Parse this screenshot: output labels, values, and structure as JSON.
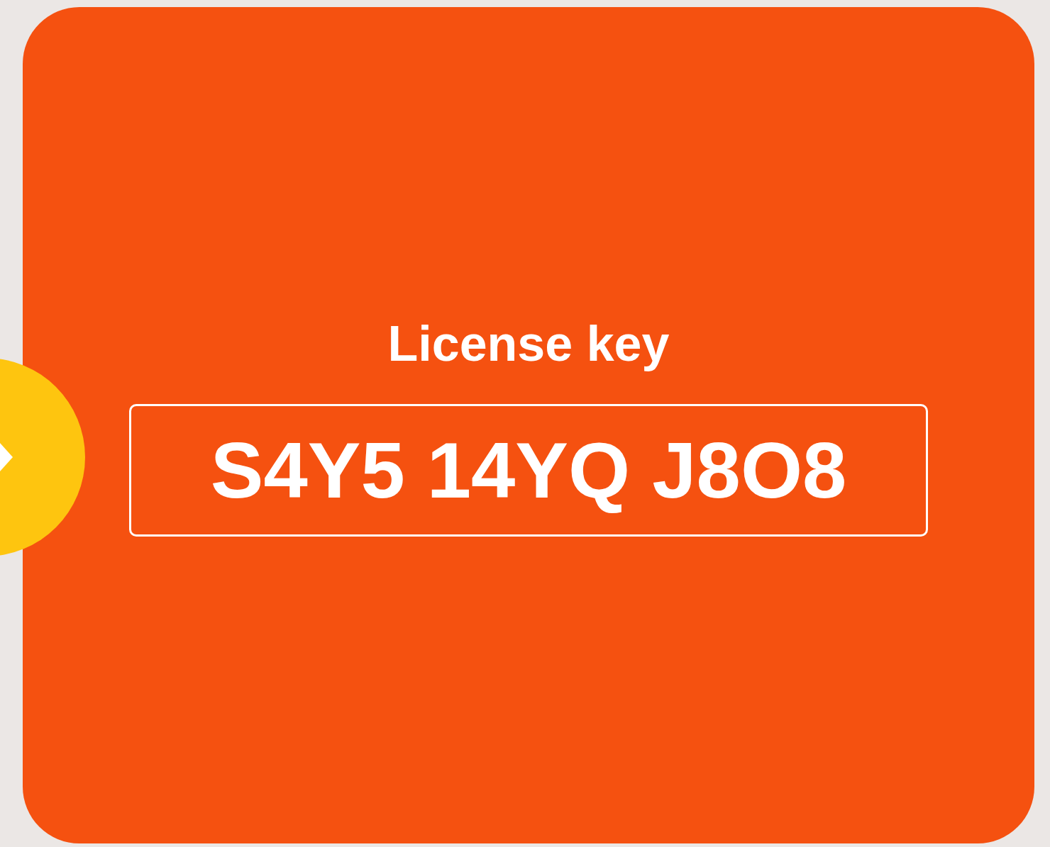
{
  "card": {
    "title": "License key",
    "license_key": "S4Y5 14YQ J8O8"
  }
}
